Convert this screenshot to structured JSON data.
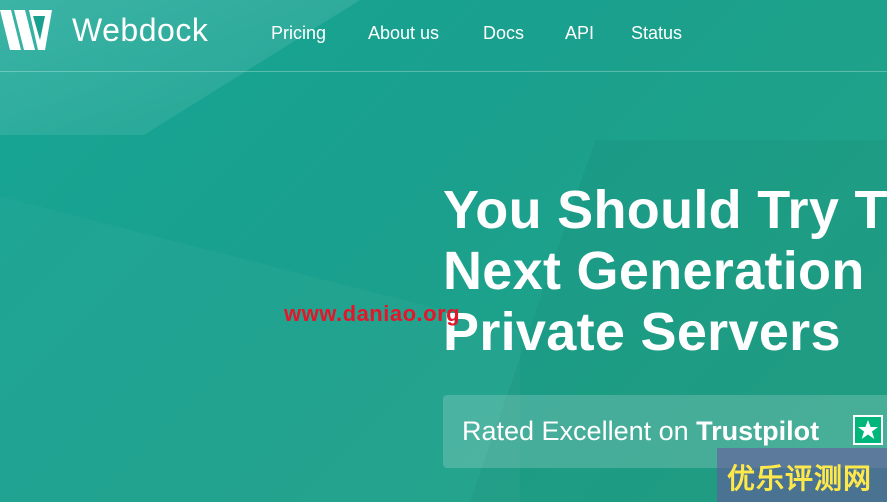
{
  "brand": {
    "name": "Webdock",
    "logo": "webdock-w-logo-icon"
  },
  "nav": {
    "items": [
      "Pricing",
      "About us",
      "Docs",
      "API",
      "Status"
    ]
  },
  "hero": {
    "title_lines": [
      "You Should Try T",
      "Next Generation",
      "Private Servers"
    ]
  },
  "trust": {
    "prefix": "Rated Excellent on ",
    "brand": "Trustpilot",
    "icon": "trustpilot-star-icon",
    "star": "★"
  },
  "overlays": {
    "watermark": "www.daniao.org",
    "corner_badge": "优乐评测网"
  },
  "colors": {
    "background": "#1aa08e",
    "trustpilot_green": "#00b67a",
    "watermark_red": "#e5152a",
    "badge_text": "#ffe94a"
  }
}
